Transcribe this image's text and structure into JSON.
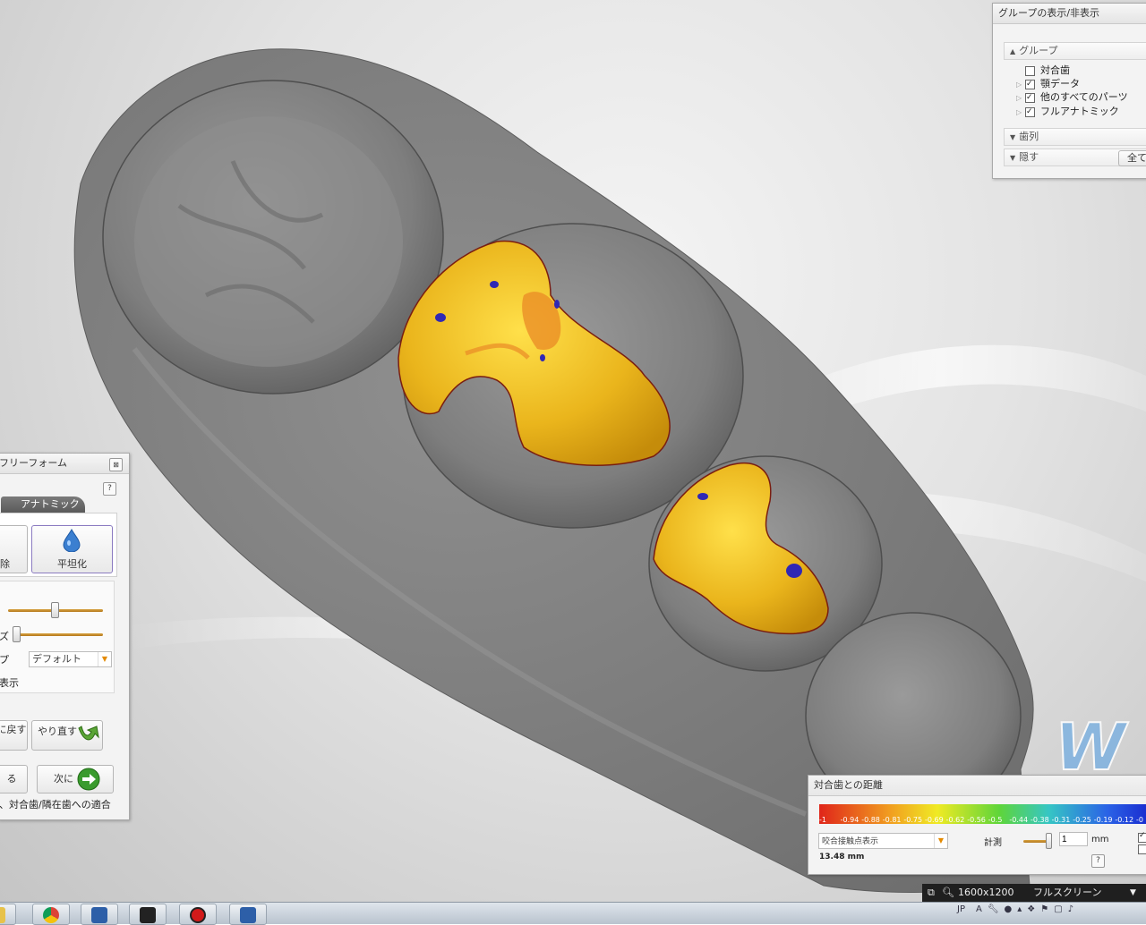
{
  "colors": {
    "tooth_gray": "#8a8a8a",
    "crown_yellow": "#e9b51c",
    "contact_blue": "#3028b4",
    "panel_bg": "#f3f3f3",
    "slider_gold": "#c48a2a"
  },
  "group_panel": {
    "title": "グループの表示/非表示",
    "group_header": "グループ",
    "items": [
      {
        "label": "対合歯",
        "checked": false,
        "expandable": false
      },
      {
        "label": "顎データ",
        "checked": true,
        "expandable": true
      },
      {
        "label": "他のすべてのパーツ",
        "checked": true,
        "expandable": true
      },
      {
        "label": "フルアナトミック",
        "checked": true,
        "expandable": true
      }
    ],
    "dentition_header": "歯列",
    "hide_header": "隠す",
    "hide_all_button": "全て"
  },
  "freeform_panel": {
    "title": "フリーフォーム",
    "close_icon": "close-icon",
    "help_label": "?",
    "tab_anatomic": "アナトミック",
    "tool_remove_label": "除",
    "tool_smooth_label": "平坦化",
    "smooth_icon": "water-drop-icon",
    "strength_slider": 0.45,
    "size_label": "ズ",
    "size_slider": 0.0,
    "type_label": "プ",
    "type_value": "デフォルト",
    "display_label": "表示",
    "undo_label": "に戻す",
    "redo_label": "やり直す",
    "back_label": "る",
    "next_label": "次に",
    "footer_text": "、対合歯/隣在歯への適合"
  },
  "distance_panel": {
    "title": "対合歯との距離",
    "scale_labels": [
      "-1",
      "-0.94",
      "-0.88",
      "-0.81",
      "-0.75",
      "-0.69",
      "-0.62",
      "-0.56",
      "-0.5",
      "-0.44",
      "-0.38",
      "-0.31",
      "-0.25",
      "-0.19",
      "-0.12",
      "-0"
    ],
    "mode_value": "咬合接触点表示",
    "measure_label": "計測",
    "measure_value": "1",
    "unit": "mm",
    "distance_value": "13.48 mm",
    "help_label": "?"
  },
  "resolution_bar": {
    "resolution": "1600x1200",
    "fullscreen_label": "フルスクリーン"
  },
  "taskbar": {
    "apps": [
      "folder-icon",
      "chrome-icon",
      "dental-app-icon",
      "media-icon",
      "record-icon",
      "dental-app-icon-2"
    ],
    "language": "JP"
  },
  "watermark": "W"
}
